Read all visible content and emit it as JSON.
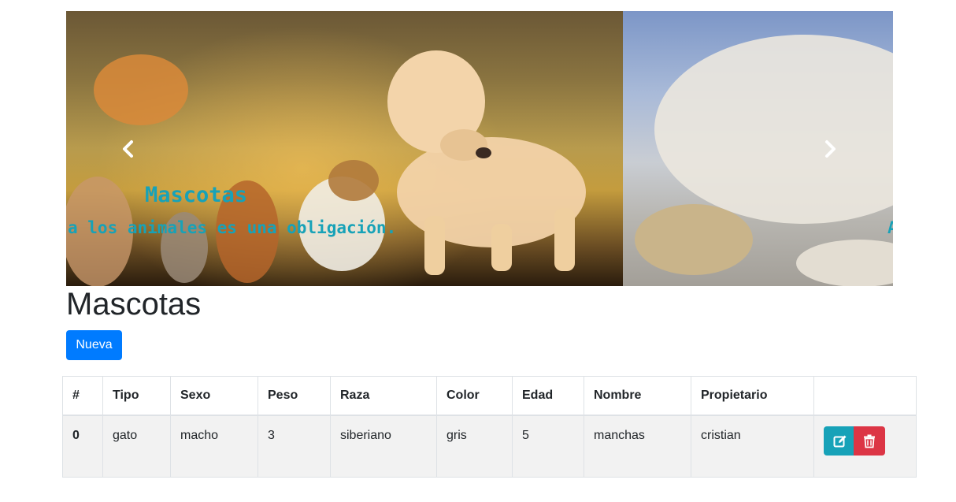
{
  "carousel": {
    "caption_title": "Mascotas",
    "caption_text": "a los animales es una obligación.",
    "caption_peek": "A",
    "prev_icon": "chevron-left-icon",
    "next_icon": "chevron-right-icon"
  },
  "page": {
    "title": "Mascotas",
    "new_button": "Nueva"
  },
  "table": {
    "headers": [
      "#",
      "Tipo",
      "Sexo",
      "Peso",
      "Raza",
      "Color",
      "Edad",
      "Nombre",
      "Propietario",
      ""
    ],
    "rows": [
      {
        "id": "0",
        "tipo": "gato",
        "sexo": "macho",
        "peso": "3",
        "raza": "siberiano",
        "color": "gris",
        "edad": "5",
        "nombre": "manchas",
        "propietario": "cristian"
      }
    ],
    "edit_icon": "edit-icon",
    "delete_icon": "trash-icon"
  }
}
